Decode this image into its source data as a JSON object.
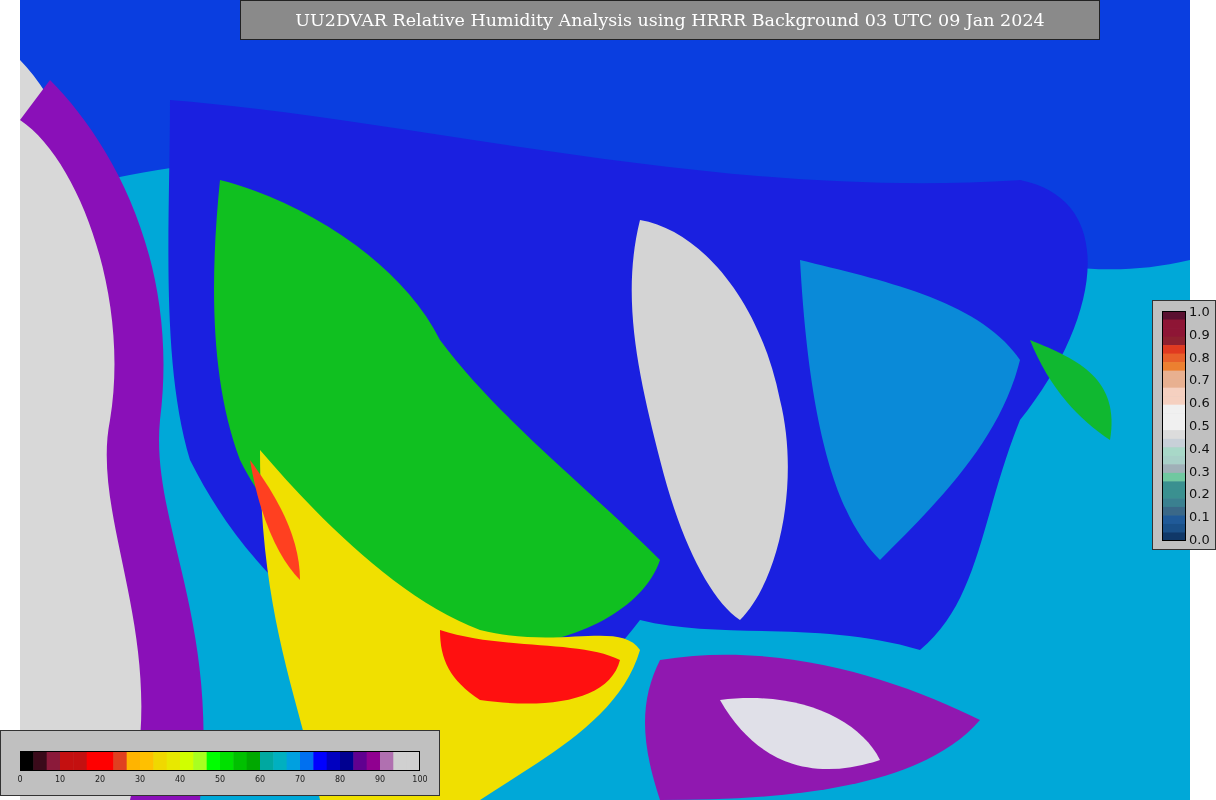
{
  "title": "UU2DVAR Relative Humidity Analysis using HRRR Background 03 UTC 09 Jan 2024",
  "humidity_legend": {
    "ticks": [
      "0",
      "10",
      "20",
      "30",
      "40",
      "50",
      "60",
      "70",
      "80",
      "90",
      "100"
    ]
  },
  "scale_legend": {
    "ticks": [
      "1.0",
      "0.9",
      "0.8",
      "0.7",
      "0.6",
      "0.5",
      "0.4",
      "0.3",
      "0.2",
      "0.1",
      "0.0"
    ]
  }
}
